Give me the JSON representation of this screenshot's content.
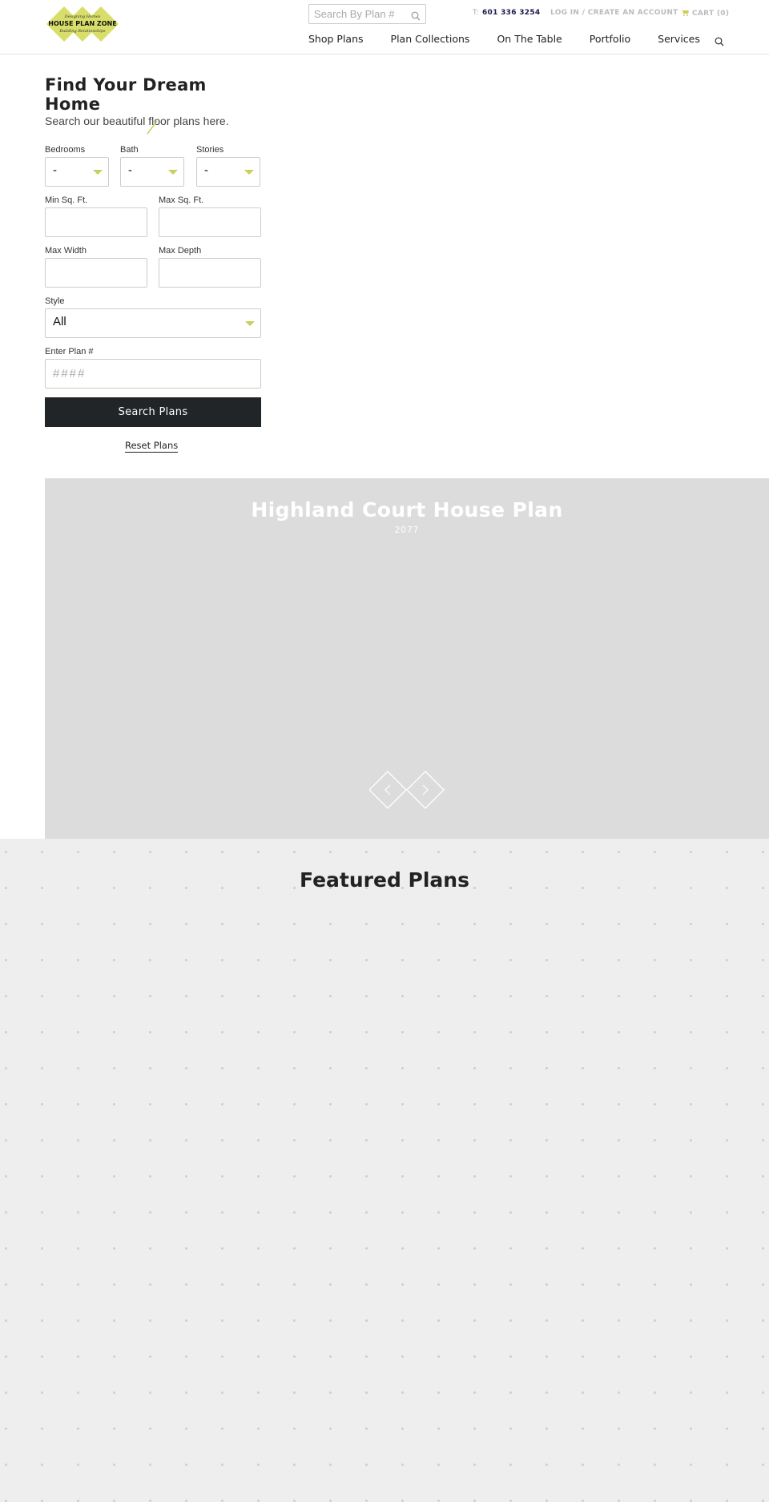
{
  "header": {
    "logo": {
      "top_tagline": "Designing Homes",
      "name": "HOUSE PLAN ZONE",
      "bottom_tagline": "Building Relationships"
    },
    "search": {
      "placeholder": "Search By Plan #",
      "value": ""
    },
    "phone_label": "T:",
    "phone": "601 336 3254",
    "account_link": "LOG IN / CREATE AN ACCOUNT",
    "cart_label": "CART (0)",
    "nav": [
      "Shop Plans",
      "Plan Collections",
      "On The Table",
      "Portfolio",
      "Services"
    ],
    "colors": {
      "accent": "#c8cf5a",
      "logo_fill": "#d9de6a",
      "button": "#212528"
    }
  },
  "search_form": {
    "title": "Find Your Dream Home",
    "subtitle": "Search our beautiful floor plans here.",
    "bedrooms": {
      "label": "Bedrooms",
      "value": "-"
    },
    "bath": {
      "label": "Bath",
      "value": "-"
    },
    "stories": {
      "label": "Stories",
      "value": "-"
    },
    "min_sqft": {
      "label": "Min Sq. Ft.",
      "value": ""
    },
    "max_sqft": {
      "label": "Max Sq. Ft.",
      "value": ""
    },
    "max_width": {
      "label": "Max Width",
      "value": ""
    },
    "max_depth": {
      "label": "Max Depth",
      "value": ""
    },
    "style": {
      "label": "Style",
      "value": "All"
    },
    "plan_number": {
      "label": "Enter Plan #",
      "placeholder": "####",
      "value": ""
    },
    "submit_label": "Search Plans",
    "reset_label": "Reset Plans"
  },
  "slider": {
    "title": "Highland Court House Plan",
    "plan_number": "2077",
    "prev_icon": "chevron-left-icon",
    "next_icon": "chevron-right-icon"
  },
  "featured": {
    "title": "Featured Plans"
  }
}
